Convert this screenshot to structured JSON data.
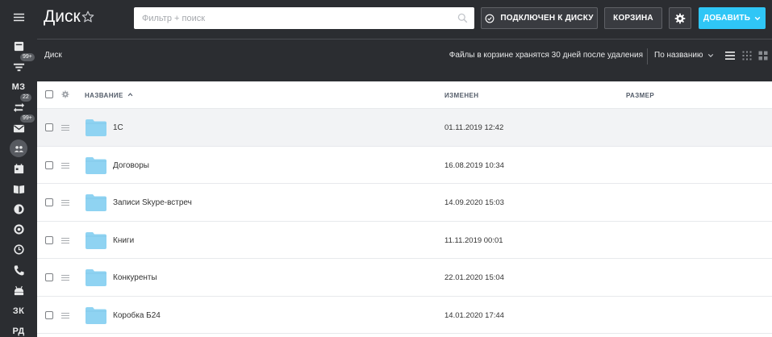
{
  "rail": {
    "badges": {
      "filter": "99+",
      "sync": "22",
      "mail": "99+"
    },
    "labels": {
      "mz": "МЗ",
      "zk": "ЗК",
      "rd": "РД"
    }
  },
  "header": {
    "title": "Диск",
    "search_placeholder": "Фильтр + поиск",
    "connect_label": "ПОДКЛЮЧЕН К ДИСКУ",
    "trash_label": "КОРЗИНА",
    "add_label": "ДОБАВИТЬ"
  },
  "toolbar": {
    "breadcrumb": "Диск",
    "trash_note": "Файлы в корзине хранятся 30 дней после удаления",
    "sort_label": "По названию"
  },
  "table": {
    "columns": {
      "name": "НАЗВАНИЕ",
      "modified": "ИЗМЕНЕН",
      "size": "РАЗМЕР"
    },
    "rows": [
      {
        "name": "1С",
        "modified": "01.11.2019 12:42"
      },
      {
        "name": "Договоры",
        "modified": "16.08.2019 10:34"
      },
      {
        "name": "Записи Skype-встреч",
        "modified": "14.09.2020 15:03"
      },
      {
        "name": "Книги",
        "modified": "11.11.2019 00:01"
      },
      {
        "name": "Конкуренты",
        "modified": "22.01.2020 15:04"
      },
      {
        "name": "Коробка Б24",
        "modified": "14.01.2020 17:44"
      }
    ]
  },
  "colors": {
    "accent": "#2fc6f6",
    "folder": "#8fd3f2",
    "header_bg": "#2b2d31"
  }
}
